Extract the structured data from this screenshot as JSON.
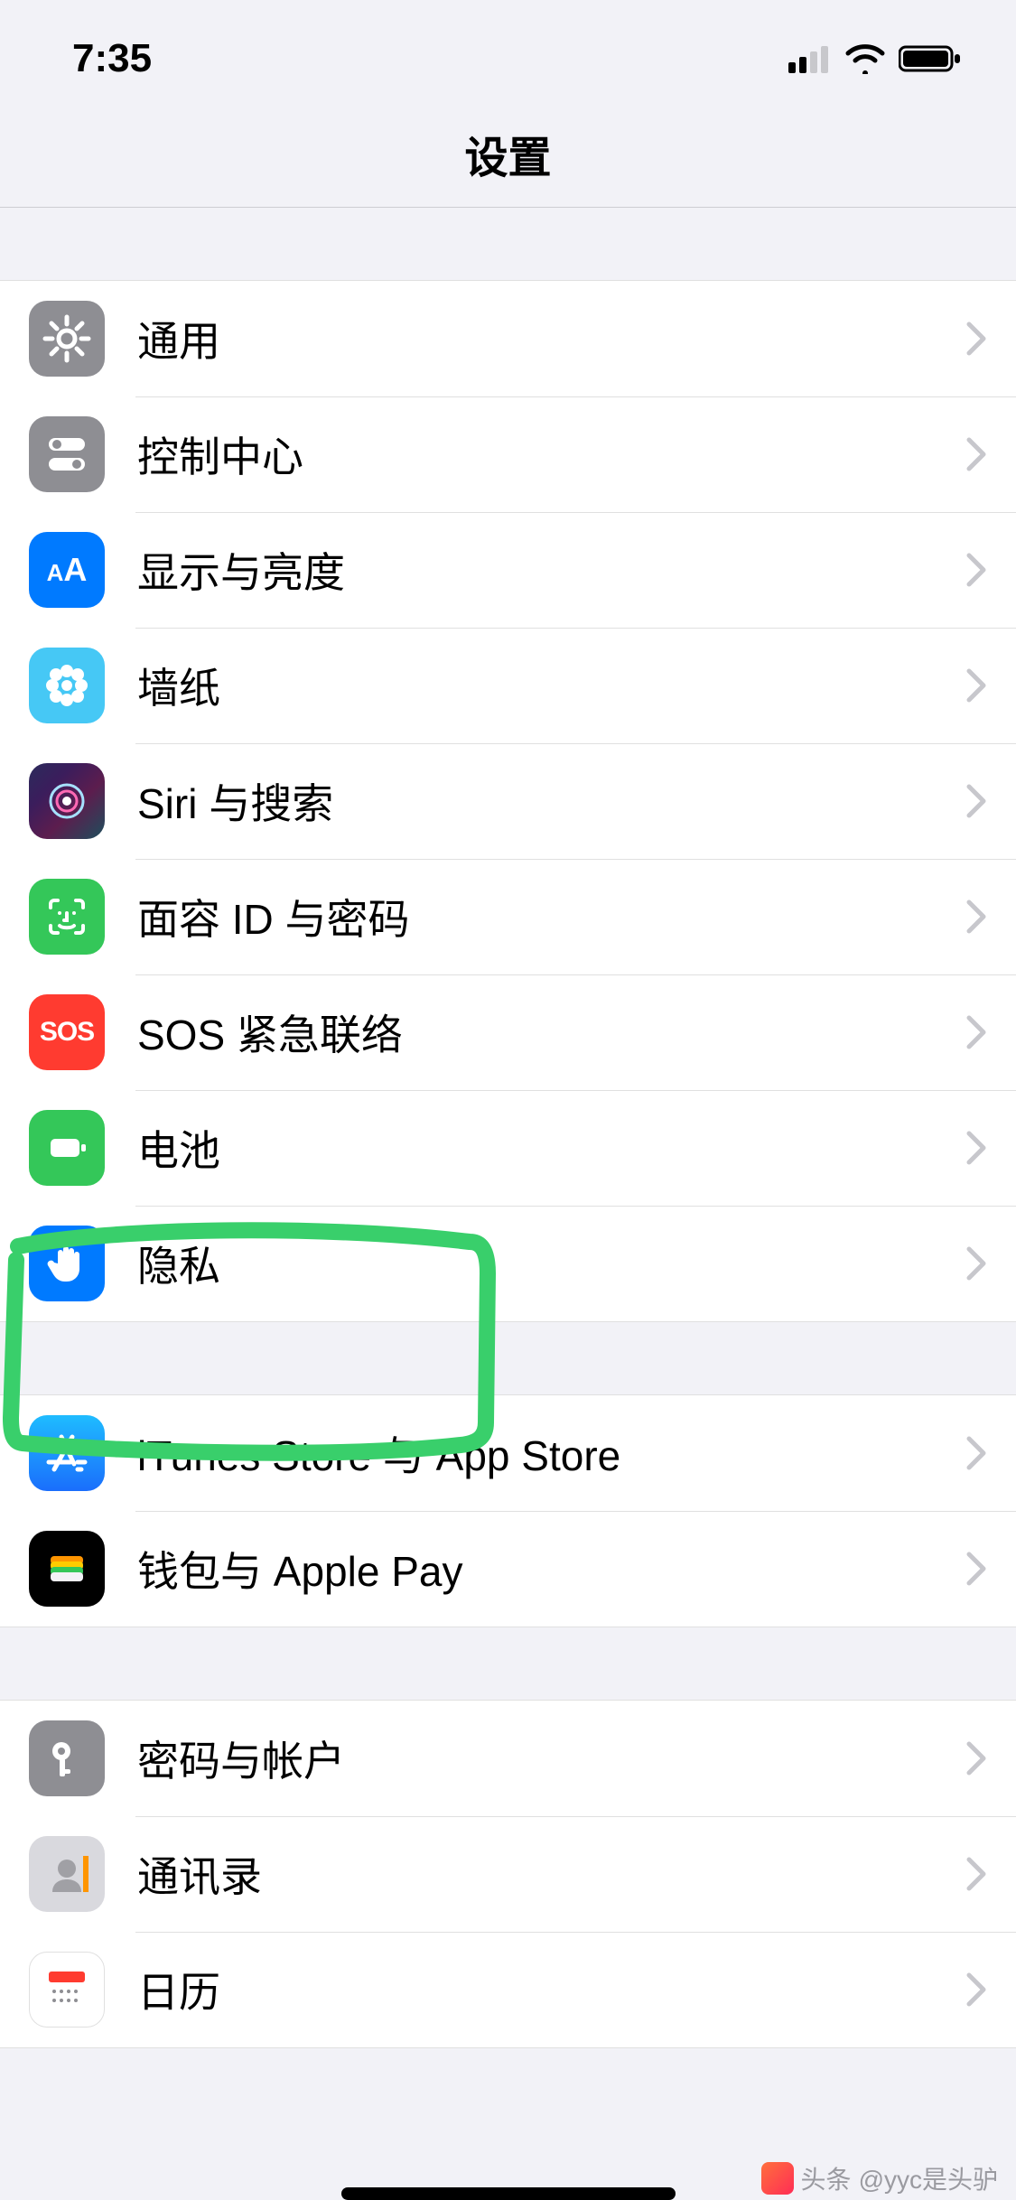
{
  "status": {
    "time": "7:35",
    "signal_bars": 2,
    "battery_level": 0.95
  },
  "header": {
    "title": "设置"
  },
  "groups": [
    {
      "rows": [
        {
          "id": "general",
          "label": "通用",
          "icon": "gear-icon",
          "interactable": true
        },
        {
          "id": "control-center",
          "label": "控制中心",
          "icon": "switches-icon",
          "interactable": true
        },
        {
          "id": "display",
          "label": "显示与亮度",
          "icon": "text-size-icon",
          "interactable": true
        },
        {
          "id": "wallpaper",
          "label": "墙纸",
          "icon": "flower-icon",
          "interactable": true
        },
        {
          "id": "siri",
          "label": "Siri 与搜索",
          "icon": "siri-icon",
          "interactable": true
        },
        {
          "id": "faceid",
          "label": "面容 ID 与密码",
          "icon": "faceid-icon",
          "interactable": true
        },
        {
          "id": "sos",
          "label": "SOS 紧急联络",
          "icon": "sos-icon",
          "interactable": true
        },
        {
          "id": "battery",
          "label": "电池",
          "icon": "battery-icon",
          "interactable": true
        },
        {
          "id": "privacy",
          "label": "隐私",
          "icon": "hand-icon",
          "interactable": true,
          "highlighted": true
        }
      ]
    },
    {
      "rows": [
        {
          "id": "itunes",
          "label": "iTunes Store 与 App Store",
          "icon": "appstore-icon",
          "interactable": true
        },
        {
          "id": "wallet",
          "label": "钱包与 Apple Pay",
          "icon": "wallet-icon",
          "interactable": true
        }
      ]
    },
    {
      "rows": [
        {
          "id": "passwords",
          "label": "密码与帐户",
          "icon": "key-icon",
          "interactable": true
        },
        {
          "id": "contacts",
          "label": "通讯录",
          "icon": "contacts-icon",
          "interactable": true
        },
        {
          "id": "calendar",
          "label": "日历",
          "icon": "calendar-icon",
          "interactable": true
        }
      ]
    }
  ],
  "watermark": {
    "prefix": "头条",
    "text": "@yyc是头驴"
  },
  "colors": {
    "highlight": "#39cf6b"
  }
}
